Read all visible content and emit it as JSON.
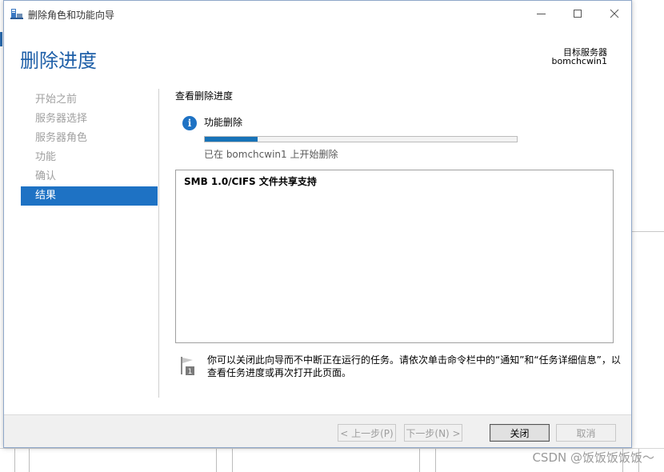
{
  "window": {
    "title": "删除角色和功能向导",
    "page_title": "删除进度",
    "target_label": "目标服务器",
    "target_server": "bomchcwin1"
  },
  "nav": {
    "items": [
      {
        "label": "开始之前",
        "active": false
      },
      {
        "label": "服务器选择",
        "active": false
      },
      {
        "label": "服务器角色",
        "active": false
      },
      {
        "label": "功能",
        "active": false
      },
      {
        "label": "确认",
        "active": false
      },
      {
        "label": "结果",
        "active": true
      }
    ]
  },
  "content": {
    "heading": "查看删除进度",
    "operation_title": "功能删除",
    "progress_fraction": 0.17,
    "operation_status": "已在 bomchcwin1 上开始删除",
    "list_items": [
      "SMB 1.0/CIFS 文件共享支持"
    ],
    "note_text": "你可以关闭此向导而不中断正在运行的任务。请依次单击命令栏中的“通知”和“任务详细信息”，以查看任务进度或再次打开此页面。"
  },
  "footer": {
    "prev_label": "< 上一步(P)",
    "next_label": "下一步(N) >",
    "close_label": "关闭",
    "cancel_label": "取消"
  },
  "watermark": "CSDN @饭饭饭饭饭～",
  "colors": {
    "accent": "#1e72c4",
    "title": "#1e5fa8"
  }
}
